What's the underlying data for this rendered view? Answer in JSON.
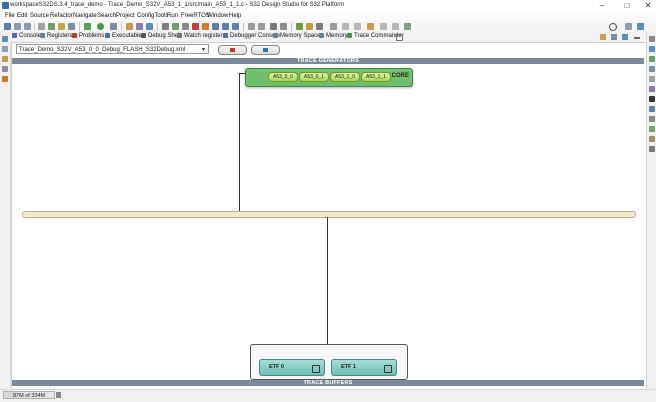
{
  "window": {
    "title": "workspaceS32DS.3.4_trace_demo - Trace_Demo_S32V_A53_1_1/src/main_A53_1_1.c - S32 Design Studio for S32 Platform",
    "controls": {
      "minimize": "–",
      "maximize": "□",
      "close": "✕"
    }
  },
  "menu": [
    "File",
    "Edit",
    "Source",
    "Refactor",
    "Navigate",
    "Search",
    "Project",
    "ConfigTools",
    "Run",
    "FreeRTOS",
    "Window",
    "Help"
  ],
  "view_tabs": [
    {
      "label": "Console",
      "color": "#4a6fa5"
    },
    {
      "label": "Registers",
      "color": "#6d7f91"
    },
    {
      "label": "Problems",
      "color": "#c0392b"
    },
    {
      "label": "Executables",
      "color": "#4a6fa5"
    },
    {
      "label": "Debug Shell",
      "color": "#555555"
    },
    {
      "label": "Watch registers",
      "color": "#777777"
    },
    {
      "label": "Debugger Console",
      "color": "#4a6fa5"
    },
    {
      "label": "Memory Spaces",
      "color": "#6d7f91"
    },
    {
      "label": "Memory",
      "color": "#6d7f91"
    },
    {
      "label": "Trace Commander",
      "color": "#4a8f4a"
    }
  ],
  "editor": {
    "config_select_value": "Trace_Demo_S32V_A53_0_0_Debug_FLASH_S32Debug.xml",
    "trace_generators_label": "TRACE GENERATORS",
    "core_label": "CORE",
    "cores": [
      "A53_0_0",
      "A53_0_1",
      "A53_1_0",
      "A53_1_1"
    ],
    "trace_buffers_label": "TRACE BUFFERS",
    "buffers": [
      "ETF 0",
      "ETF 1"
    ]
  },
  "status": {
    "heap_text": "87M of 334M",
    "heap_fraction": 0.26
  },
  "colors": {
    "band": "#7a8a9a",
    "core_green": "#6fbf6f",
    "etf_teal": "#6ebfb5",
    "bus": "#f3e9d2"
  }
}
